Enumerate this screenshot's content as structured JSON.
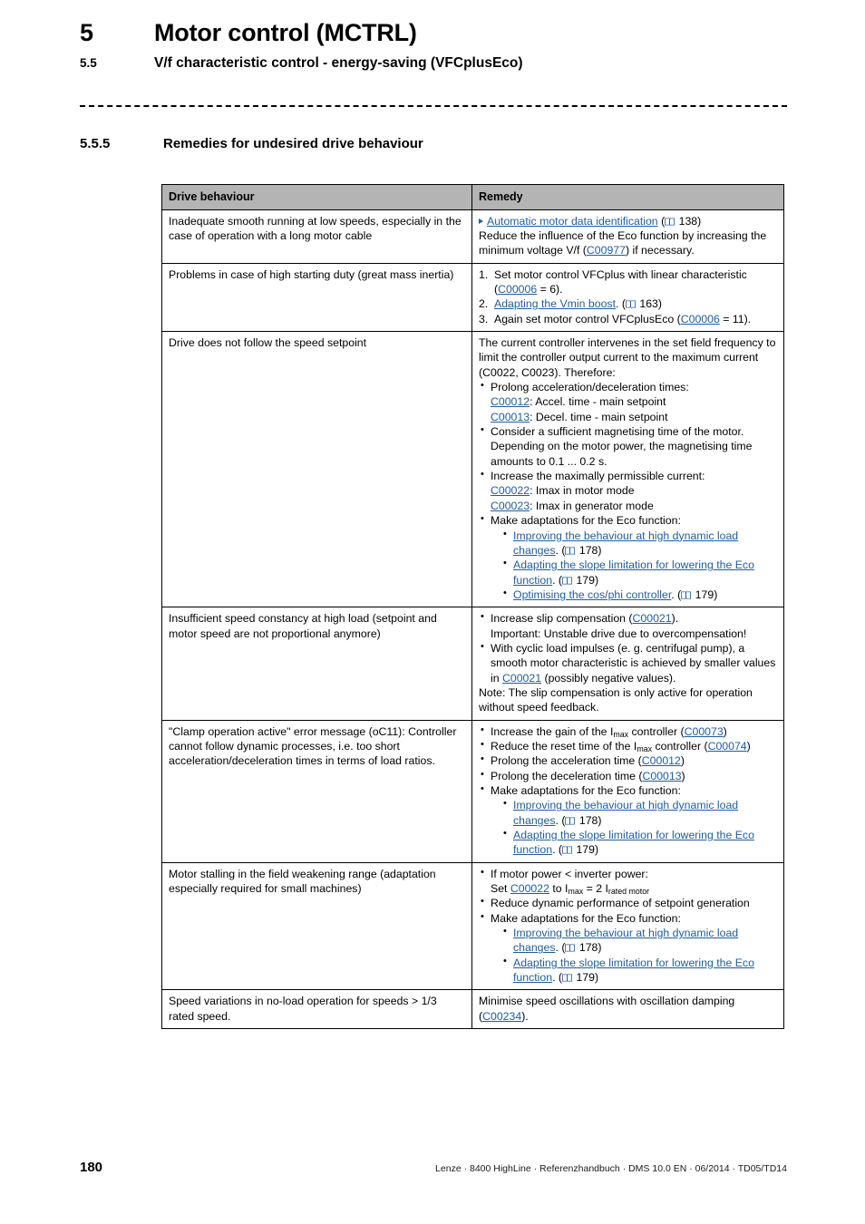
{
  "header": {
    "chapter_number": "5",
    "chapter_title": "Motor control (MCTRL)",
    "section_number": "5.5",
    "section_title": "V/f characteristic control - energy-saving (VFCplusEco)",
    "subsection_number": "5.5.5",
    "subsection_title": "Remedies for undesired drive behaviour"
  },
  "table": {
    "columns": [
      "Drive behaviour",
      "Remedy"
    ],
    "rows": [
      {
        "behaviour": "Inadequate smooth running at low speeds, especially in the case of operation with a long motor cable",
        "remedy": {
          "link_line": {
            "text": "Automatic motor data identification",
            "page": "138"
          },
          "paragraph_a": "Reduce the influence of the Eco function by increasing the minimum voltage V/f (",
          "param_a": "C00977",
          "paragraph_b": ") if necessary."
        }
      },
      {
        "behaviour": "Problems in case of high starting duty (great mass inertia)",
        "remedy": {
          "step1_a": "Set motor control VFCplus with linear characteristic (",
          "step1_param": "C00006",
          "step1_b": " = 6).",
          "step2_link": "Adapting the Vmin boost",
          "step2_page": "163",
          "step3_a": "Again set motor control VFCplusEco (",
          "step3_param": "C00006",
          "step3_b": " = 11)."
        }
      },
      {
        "behaviour": "Drive does not follow the speed setpoint",
        "remedy": {
          "intro": "The current controller intervenes in the set field frequency to limit the controller output current to the maximum current (C0022, C0023). Therefore:",
          "b1": "Prolong acceleration/deceleration times:",
          "b1_p1": "C00012",
          "b1_t1": ": Accel. time - main setpoint",
          "b1_p2": "C00013",
          "b1_t2": ": Decel. time - main setpoint",
          "b2": "Consider a sufficient magnetising time of the motor. Depending on the motor power, the magnetising time amounts to 0.1 ... 0.2 s.",
          "b3": "Increase the maximally permissible current:",
          "b3_p1": "C00022",
          "b3_t1": ": Imax in motor mode",
          "b3_p2": "C00023",
          "b3_t2": ": Imax in generator mode",
          "b4": "Make adaptations for the Eco function:",
          "sub1_link": "Improving the behaviour at high dynamic load changes",
          "sub1_page": "178",
          "sub2_link": "Adapting the slope limitation for lowering the Eco function",
          "sub2_page": "179",
          "sub3_link": "Optimising the cos/phi controller",
          "sub3_page": "179"
        }
      },
      {
        "behaviour": "Insufficient speed constancy at high load (setpoint and motor speed are not proportional anymore)",
        "remedy": {
          "b1_a": "Increase slip compensation (",
          "b1_param": "C00021",
          "b1_b": ").",
          "b1_note": "Important: Unstable drive due to overcompensation!",
          "b2_a": "With cyclic load impulses (e. g. centrifugal pump), a smooth motor characteristic is achieved by smaller values in ",
          "b2_param": "C00021",
          "b2_b": " (possibly negative values).",
          "note": "Note: The slip compensation is only active for operation without speed feedback."
        }
      },
      {
        "behaviour": "\"Clamp operation active\" error message (oC11): Controller cannot follow dynamic processes, i.e. too short acceleration/deceleration times in terms of load ratios.",
        "remedy": {
          "b1_a": "Increase the gain of the I",
          "b1_sub": "max",
          "b1_b": " controller (",
          "b1_param": "C00073",
          "b1_c": ")",
          "b2_a": "Reduce the reset time of the I",
          "b2_sub": "max",
          "b2_b": " controller (",
          "b2_param": "C00074",
          "b2_c": ")",
          "b3_a": "Prolong the acceleration time (",
          "b3_param": "C00012",
          "b3_b": ")",
          "b4_a": "Prolong the deceleration time (",
          "b4_param": "C00013",
          "b4_b": ")",
          "b5": "Make adaptations for the Eco function:",
          "sub1_link": "Improving the behaviour at high dynamic load changes",
          "sub1_page": "178",
          "sub2_link": "Adapting the slope limitation for lowering the Eco function",
          "sub2_page": "179"
        }
      },
      {
        "behaviour": "Motor stalling in the field weakening range (adaptation especially required for small machines)",
        "remedy": {
          "b1": "If motor power < inverter power:",
          "b1_set": "Set ",
          "b1_param": "C00022",
          "b1_to": " to I",
          "b1_sub1": "max",
          "b1_eq": " = 2 I",
          "b1_sub2": "rated motor",
          "b2": "Reduce dynamic performance of setpoint generation",
          "b3": "Make adaptations for the Eco function:",
          "sub1_link": "Improving the behaviour at high dynamic load changes",
          "sub1_page": "178",
          "sub2_link": "Adapting the slope limitation for lowering the Eco function",
          "sub2_page": "179"
        }
      },
      {
        "behaviour": "Speed variations in no-load operation for speeds > 1/3 rated speed.",
        "remedy": {
          "text_a": "Minimise speed oscillations with oscillation damping (",
          "param": "C00234",
          "text_b": ")."
        }
      }
    ]
  },
  "footer": {
    "page_number": "180",
    "document_line": "Lenze · 8400 HighLine · Referenzhandbuch · DMS 10.0 EN · 06/2014 · TD05/TD14"
  },
  "colors": {
    "link": "#1f5c9e",
    "table_header_bg": "#b4b4b4"
  }
}
